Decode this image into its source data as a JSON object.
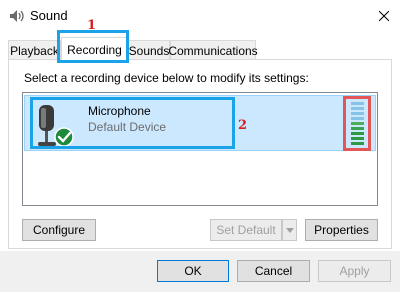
{
  "window": {
    "title": "Sound",
    "icon": "speaker-icon",
    "close_icon": "close-icon"
  },
  "tabs": [
    {
      "label": "Playback",
      "selected": false
    },
    {
      "label": "Recording",
      "selected": true
    },
    {
      "label": "Sounds",
      "selected": false
    },
    {
      "label": "Communications",
      "selected": false
    }
  ],
  "panel": {
    "instructions": "Select a recording device below to modify its settings:"
  },
  "devices": [
    {
      "name": "Microphone",
      "status": "Default Device",
      "icon": "microphone-icon",
      "badge": "check-icon",
      "selected": true
    }
  ],
  "buttons": {
    "configure": "Configure",
    "set_default": "Set Default",
    "properties": "Properties",
    "ok": "OK",
    "cancel": "Cancel",
    "apply": "Apply"
  },
  "annotations": {
    "step1": "1",
    "step2": "2"
  },
  "colors": {
    "selection": "#cce8ff",
    "annotation_blue": "#1aa3e8",
    "annotation_red": "#e35656",
    "annotation_number": "#d92020"
  }
}
